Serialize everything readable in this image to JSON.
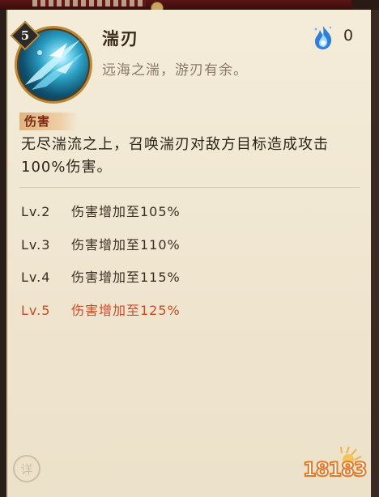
{
  "skill": {
    "level": "5",
    "name": "湍刃",
    "flavor": "远海之湍，游刃有余。",
    "cost": "0",
    "icon": "water-blade-icon",
    "cost_icon": "blue-flame-icon"
  },
  "tag": "伤害",
  "description": "无尽湍流之上，召唤湍刃对敌方目标造成攻击100%伤害。",
  "levels": [
    {
      "lv": "Lv.2",
      "effect": "伤害增加至105%"
    },
    {
      "lv": "Lv.3",
      "effect": "伤害增加至110%"
    },
    {
      "lv": "Lv.4",
      "effect": "伤害增加至115%"
    },
    {
      "lv": "Lv.5",
      "effect": "伤害增加至125%"
    }
  ],
  "detail_button": "详",
  "watermark": "18183",
  "colors": {
    "active_level": "#c94a24",
    "parchment": "#f4ecd9",
    "tag_bg": "#e0b480"
  }
}
